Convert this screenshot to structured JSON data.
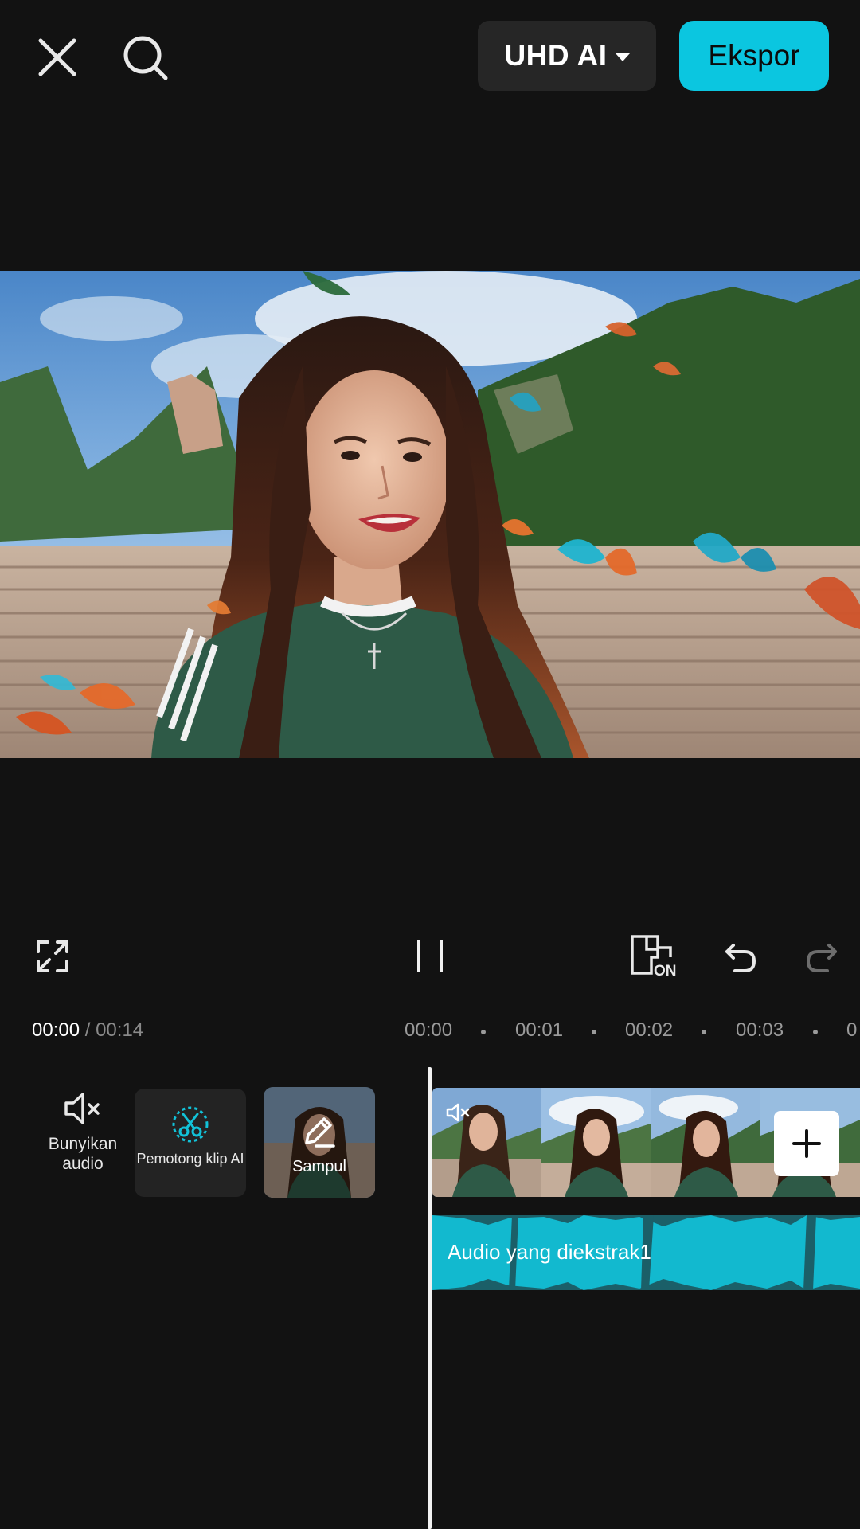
{
  "topbar": {
    "close_icon": "close-icon",
    "search_icon": "search-icon",
    "quality_label": "UHD AI",
    "export_label": "Ekspor"
  },
  "preview": {
    "content": "video-frame"
  },
  "controls": {
    "fullscreen_icon": "fullscreen-icon",
    "pause_icon": "pause-icon",
    "keyframe_badge": "ON",
    "undo_icon": "undo-icon",
    "redo_icon": "redo-icon"
  },
  "timecode": {
    "current": "00:00",
    "separator": "/",
    "total": "00:14"
  },
  "ruler": {
    "ticks": [
      "00:00",
      "00:01",
      "00:02",
      "00:03",
      "0"
    ]
  },
  "tools": {
    "mute_label": "Bunyikan audio",
    "cutter_label": "Pemotong klip AI",
    "cover_label": "Sampul"
  },
  "timeline": {
    "audio_label": "Audio yang diekstrak1",
    "colors": {
      "accent": "#0bc6e0",
      "audio_wave": "#12b9cf",
      "audio_bg": "#1b5f68"
    }
  }
}
